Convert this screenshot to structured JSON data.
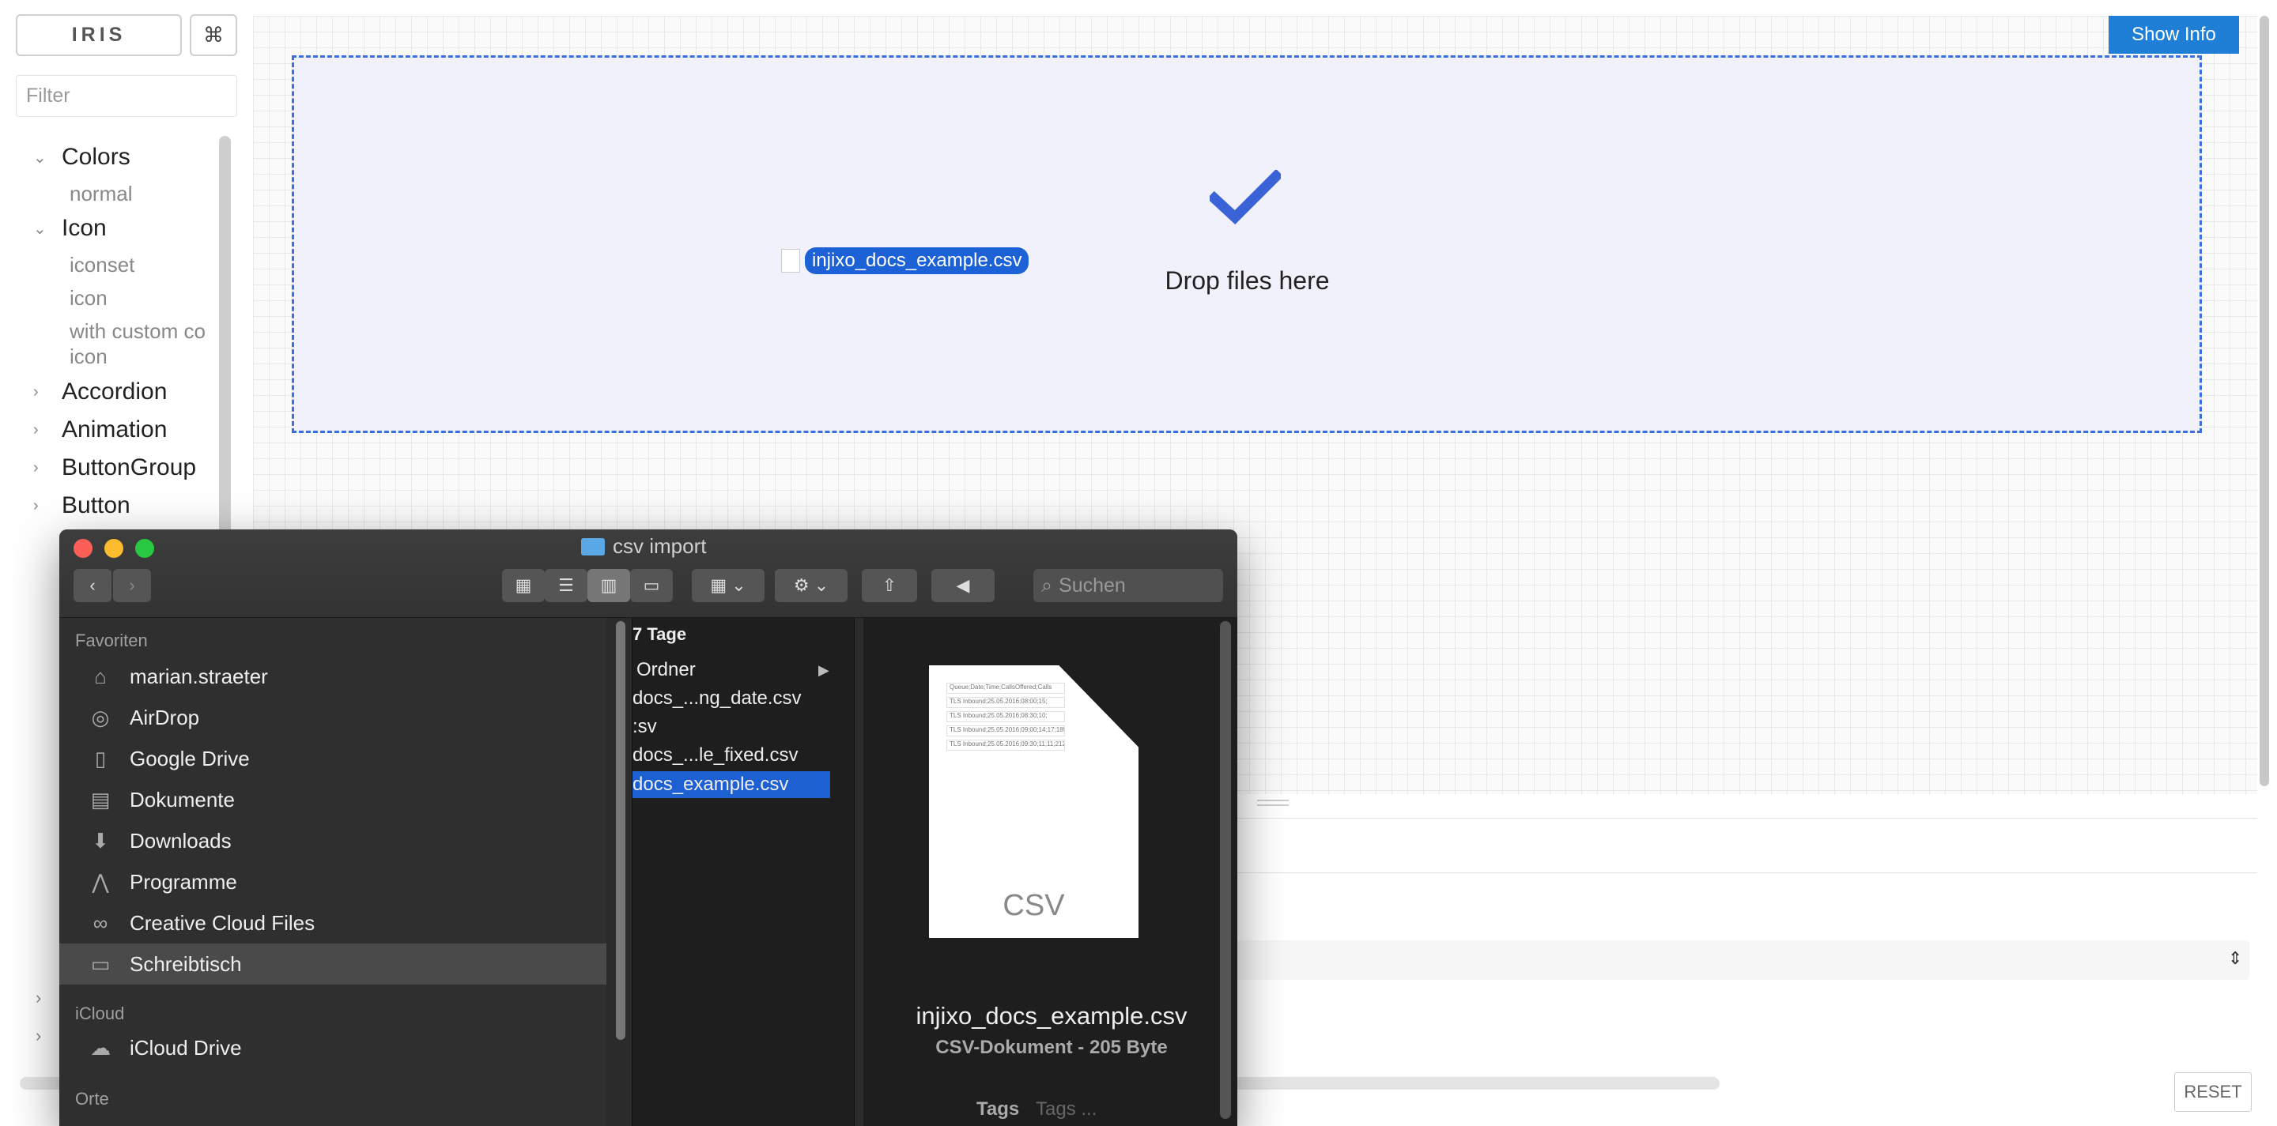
{
  "sidebar": {
    "brand": "IRIS",
    "cmd": "⌘",
    "filter_placeholder": "Filter",
    "items": [
      {
        "label": "Colors"
      },
      {
        "label": "normal"
      },
      {
        "label": "Icon"
      },
      {
        "label": "iconset"
      },
      {
        "label": "icon"
      },
      {
        "label": "with custom co"
      },
      {
        "label": "icon"
      },
      {
        "label": "Accordion"
      },
      {
        "label": "Animation"
      },
      {
        "label": "ButtonGroup"
      },
      {
        "label": "Button"
      }
    ]
  },
  "canvas": {
    "show_info": "Show Info",
    "drop_text": "Drop files here",
    "dragged_file": "injixo_docs_example.csv"
  },
  "addons": {
    "reset": "RESET"
  },
  "finder": {
    "title": "csv import",
    "search_placeholder": "Suchen",
    "favorites_header": "Favoriten",
    "favorites": [
      {
        "label": "marian.straeter",
        "icon": "home-icon"
      },
      {
        "label": "AirDrop",
        "icon": "airdrop-icon"
      },
      {
        "label": "Google Drive",
        "icon": "document-icon"
      },
      {
        "label": "Dokumente",
        "icon": "documents-icon"
      },
      {
        "label": "Downloads",
        "icon": "download-icon"
      },
      {
        "label": "Programme",
        "icon": "apps-icon"
      },
      {
        "label": "Creative Cloud Files",
        "icon": "creative-cloud-icon"
      },
      {
        "label": "Schreibtisch",
        "icon": "desktop-icon"
      }
    ],
    "icloud_header": "iCloud",
    "icloud": [
      {
        "label": "iCloud Drive",
        "icon": "cloud-icon"
      }
    ],
    "places_header": "Orte",
    "column": {
      "header": "7 Tage",
      "items": [
        "Ordner",
        "docs_...ng_date.csv",
        ":sv",
        "docs_...le_fixed.csv",
        "docs_example.csv"
      ]
    },
    "preview": {
      "name": "injixo_docs_example.csv",
      "kind": "CSV-Dokument - 205 Byte",
      "tags_label": "Tags",
      "tags_placeholder": "Tags ...",
      "badge": "CSV",
      "rows": [
        "Queue;Date;Time;CallsOffered;Calls",
        "TLS Inbound;25.05.2016;08:00;15;",
        "TLS Inbound;25.05.2016;08:30;10;",
        "TLS Inbound;25.05.2016;09:00;14;17;189;",
        "TLS Inbound;25.05.2016;09:30;11;11;212;"
      ]
    }
  }
}
